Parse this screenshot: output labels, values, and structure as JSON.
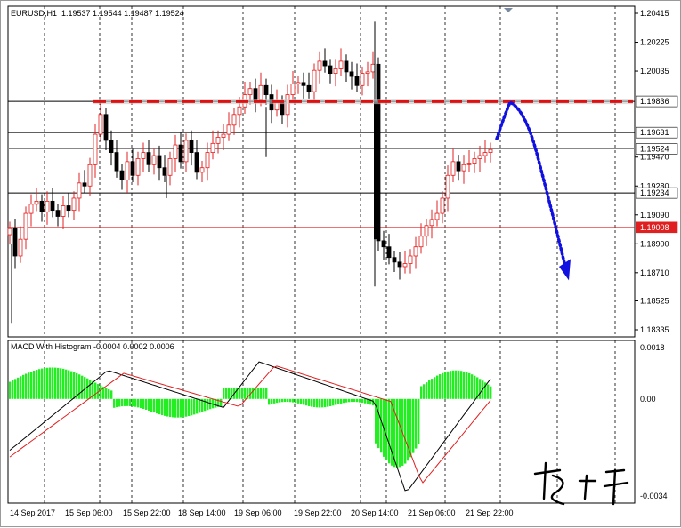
{
  "header": {
    "symbol_line": "EURUSD,H1  1.19537 1.19544 1.19487 1.19524"
  },
  "macd_header": "MACD With Histogram -0.0004 0.0002 0.0006",
  "chart_data": {
    "type": "candlestick",
    "symbol": "EURUSD",
    "timeframe": "H1",
    "price_axis": {
      "ticks": [
        "1.20415",
        "1.20225",
        "1.20035",
        "1.19470",
        "1.19280",
        "1.19090",
        "1.18900",
        "1.18710",
        "1.18525",
        "1.18335"
      ],
      "ylim": [
        1.18335,
        1.20415
      ]
    },
    "time_axis": {
      "ticks": [
        "14 Sep 2017",
        "15 Sep 06:00",
        "15 Sep 22:00",
        "18 Sep 14:00",
        "19 Sep 06:00",
        "19 Sep 22:00",
        "20 Sep 14:00",
        "21 Sep 06:00",
        "21 Sep 22:00"
      ]
    },
    "levels": [
      {
        "value": "1.19836",
        "label": "1.19836",
        "color": "#000000",
        "tag_bg": "#ffffff",
        "style": "solid"
      },
      {
        "value": "1.19631",
        "label": "1.19631",
        "color": "#000000",
        "tag_bg": "#ffffff",
        "style": "solid"
      },
      {
        "value": "1.19524",
        "label": "1.19524",
        "color": "#888888",
        "tag_bg": "#ffffff",
        "style": "solid"
      },
      {
        "value": "1.19234",
        "label": "1.19234",
        "color": "#000000",
        "tag_bg": "#ffffff",
        "style": "solid"
      },
      {
        "value": "1.19008",
        "label": "1.19008",
        "color": "#e02020",
        "tag_bg": "#e02020",
        "style": "solid"
      }
    ],
    "resistance_line": {
      "value": 1.19836,
      "color": "#e01010",
      "style": "dashed"
    },
    "projection": {
      "color": "#1010e0",
      "style": "dotted",
      "points": [
        [
          1.1963,
          "21 Sep 22:00"
        ],
        [
          1.1983,
          "peak"
        ],
        [
          1.1871,
          "target"
        ]
      ]
    },
    "macd": {
      "ticks": [
        "0.0018",
        "0.00",
        "-0.0034"
      ],
      "ylim": [
        -0.0034,
        0.0018
      ],
      "main_color": "#000000",
      "signal_color": "#e02020",
      "histogram_color": "#22ee22"
    },
    "colors": {
      "bull": "#e02020",
      "bear": "#000000",
      "grid": "#000000"
    }
  }
}
